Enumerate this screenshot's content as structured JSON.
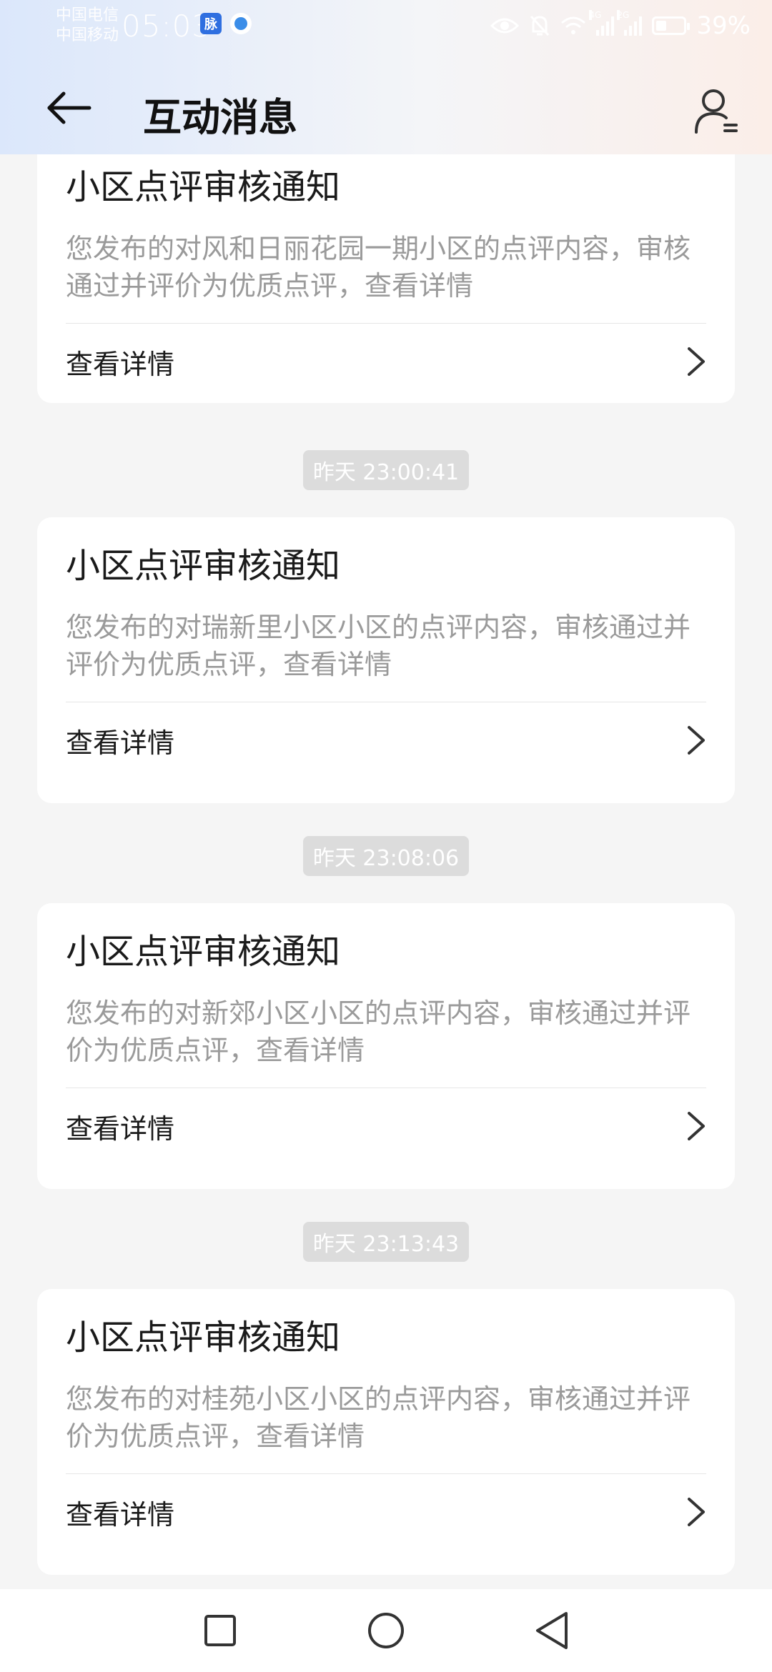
{
  "status_bar": {
    "carrier_1": "中国电信",
    "carrier_2": "中国移动",
    "time": "05:03",
    "app_badge": "脉",
    "network_tag_1": "4G",
    "network_tag_2": "2G",
    "battery_percent": "39%",
    "battery_level": 0.39
  },
  "nav": {
    "title": "互动消息"
  },
  "messages": [
    {
      "title": "小区点评审核通知",
      "body": "您发布的对风和日丽花园一期小区的点评内容，审核通过并评价为优质点评，查看详情",
      "action": "查看详情"
    },
    {
      "timestamp": "昨天 23:00:41",
      "title": "小区点评审核通知",
      "body": "您发布的对瑞新里小区小区的点评内容，审核通过并评价为优质点评，查看详情",
      "action": "查看详情"
    },
    {
      "timestamp": "昨天 23:08:06",
      "title": "小区点评审核通知",
      "body": "您发布的对新郊小区小区的点评内容，审核通过并评价为优质点评，查看详情",
      "action": "查看详情"
    },
    {
      "timestamp": "昨天 23:13:43",
      "title": "小区点评审核通知",
      "body": "您发布的对桂苑小区小区的点评内容，审核通过并评价为优质点评，查看详情",
      "action": "查看详情"
    }
  ]
}
